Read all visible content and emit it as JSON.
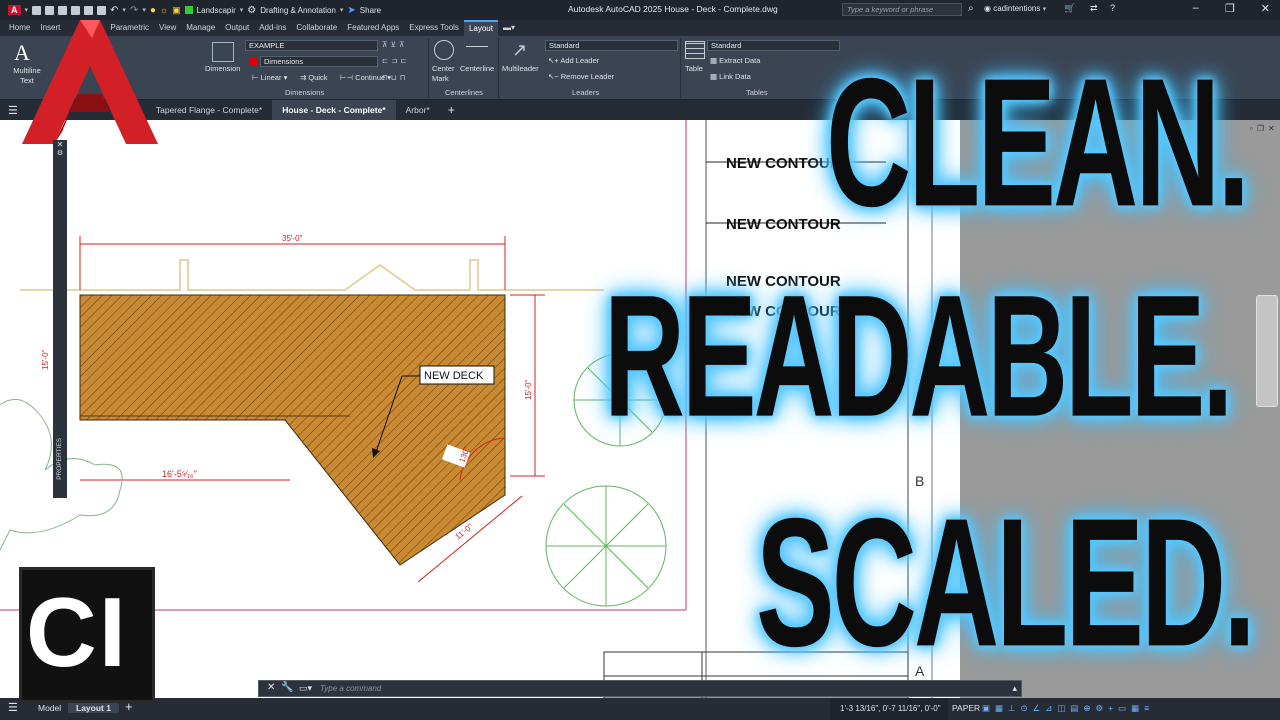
{
  "app": {
    "title": "Autodesk AutoCAD 2025   House - Deck - Complete.dwg",
    "workspace": "Drafting & Annotation",
    "layer": "Landscapir",
    "share": "Share",
    "search_placeholder": "Type a keyword or phrase",
    "user": "cadintentions",
    "logo": "autocad-a-logo"
  },
  "ribbon_tabs": [
    "Home",
    "Insert",
    "Parametric",
    "View",
    "Manage",
    "Output",
    "Add-ins",
    "Collaborate",
    "Featured Apps",
    "Express Tools",
    "Layout"
  ],
  "ribbon_active_tab": "Layout",
  "ribbon": {
    "text": {
      "multiline_text": "Multiline Text"
    },
    "dimensions": {
      "dimension_btn": "Dimension",
      "style_combo": "EXAMPLE",
      "layer_combo": "Dimensions",
      "linear": "Linear",
      "quick": "Quick",
      "continue": "Continue",
      "panel_title": "Dimensions"
    },
    "centerlines": {
      "center_mark": "Center Mark",
      "centerline": "Centerline",
      "panel_title": "Centerlines"
    },
    "leaders": {
      "multileader": "Multileader",
      "style_combo": "Standard",
      "add_leader": "Add Leader",
      "remove_leader": "Remove Leader",
      "panel_title": "Leaders"
    },
    "tables": {
      "table_btn": "Table",
      "style_combo": "Standard",
      "extract_data": "Extract Data",
      "link_data": "Link Data",
      "panel_title": "Tables"
    }
  },
  "file_tabs": [
    {
      "label": "Tapered Flange - Complete*",
      "active": false
    },
    {
      "label": "House - Deck - Complete*",
      "active": true
    },
    {
      "label": "Arbor*",
      "active": false
    }
  ],
  "drawing": {
    "dim_top": "35'-0\"",
    "dim_right": "15'-0\"",
    "dim_left": "15'-0\"",
    "dim_bottom_left": "16'-5⁵⁄₁₆\"",
    "dim_diagonal": "11'-0\"",
    "dim_angle": "130°",
    "leader_label": "NEW DECK",
    "contours": [
      "NEW CONTOUR",
      "NEW CONTOUR",
      "NEW CONTOUR",
      "NEW CONTOUR"
    ],
    "title_block_letters": [
      "B",
      "A"
    ],
    "properties_label": "PROPERTIES",
    "deck_color": "#c98a33"
  },
  "command_line": {
    "placeholder": "Type a command"
  },
  "status_bar": {
    "tabs": [
      "Model",
      "Layout 1"
    ],
    "coords": "1'-3 13/16\", 0'-7 11/16\", 0'-0\"",
    "space": "PAPER"
  },
  "overlay": {
    "line1": "CLEAN.",
    "line2": "READABLE.",
    "line3": "SCALED.",
    "badge": "CI",
    "glow_color": "#59c9ff"
  }
}
